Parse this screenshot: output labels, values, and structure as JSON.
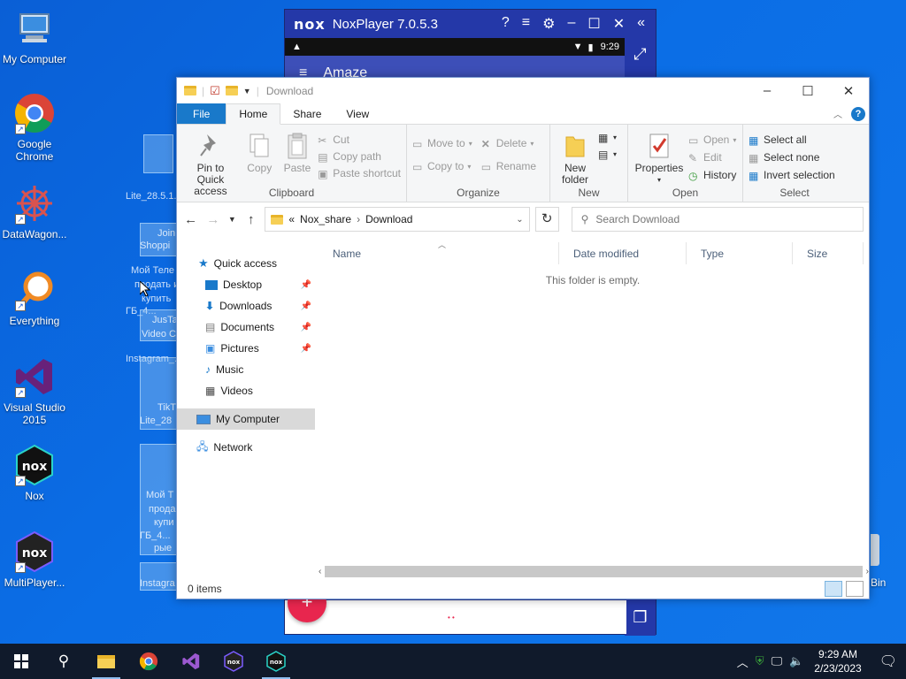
{
  "desktop": {
    "icons": [
      {
        "label": "My Computer"
      },
      {
        "label": "Google Chrome"
      },
      {
        "label": "DataWagon..."
      },
      {
        "label": "Everything"
      },
      {
        "label": "Visual Studio 2015"
      },
      {
        "label": "Nox"
      },
      {
        "label": "MultiPlayer..."
      }
    ],
    "recycle_partial": "Bin",
    "ghost_texts": [
      "Lite_28.5.1...",
      "Мой Теле",
      "продать и",
      "купить",
      "ГБ_4...",
      "Instagram_...",
      "Lite_28",
      "Мой Т",
      "прода",
      "купи",
      "ГБ_4...",
      "рые",
      "Instagra",
      "Join",
      "Shoppi",
      "JusTa",
      "Video C",
      "TikT",
      "Lite_28"
    ]
  },
  "nox": {
    "title": "NoxPlayer 7.0.5.3",
    "logo": "nox",
    "status_time": "9:29",
    "app_title": "Amaze"
  },
  "explorer": {
    "title": "Download",
    "tabs": [
      "File",
      "Home",
      "Share",
      "View"
    ],
    "ribbon": {
      "clipboard": {
        "label": "Clipboard",
        "pin": "Pin to Quick access",
        "copy": "Copy",
        "paste": "Paste",
        "cut": "Cut",
        "copy_path": "Copy path",
        "paste_shortcut": "Paste shortcut"
      },
      "organize": {
        "label": "Organize",
        "move_to": "Move to",
        "copy_to": "Copy to",
        "delete": "Delete",
        "rename": "Rename"
      },
      "new": {
        "label": "New",
        "new_folder": "New folder"
      },
      "open": {
        "label": "Open",
        "properties": "Properties",
        "open": "Open",
        "edit": "Edit",
        "history": "History"
      },
      "select": {
        "label": "Select",
        "select_all": "Select all",
        "select_none": "Select none",
        "invert": "Invert selection"
      }
    },
    "address": {
      "prefix": "«",
      "parts": [
        "Nox_share",
        "Download"
      ]
    },
    "search_placeholder": "Search Download",
    "nav": {
      "quick_access": "Quick access",
      "items": [
        "Desktop",
        "Downloads",
        "Documents",
        "Pictures",
        "Music",
        "Videos"
      ],
      "my_computer": "My Computer",
      "network": "Network"
    },
    "columns": [
      "Name",
      "Date modified",
      "Type",
      "Size"
    ],
    "empty_message": "This folder is empty.",
    "status": "0 items"
  },
  "taskbar": {
    "time": "9:29 AM",
    "date": "2/23/2023"
  },
  "colors": {
    "desktop_bg": "#0b6ee6",
    "file_tab": "#1979ca",
    "nox_blue": "#2438a8",
    "fab": "#e8264e"
  }
}
